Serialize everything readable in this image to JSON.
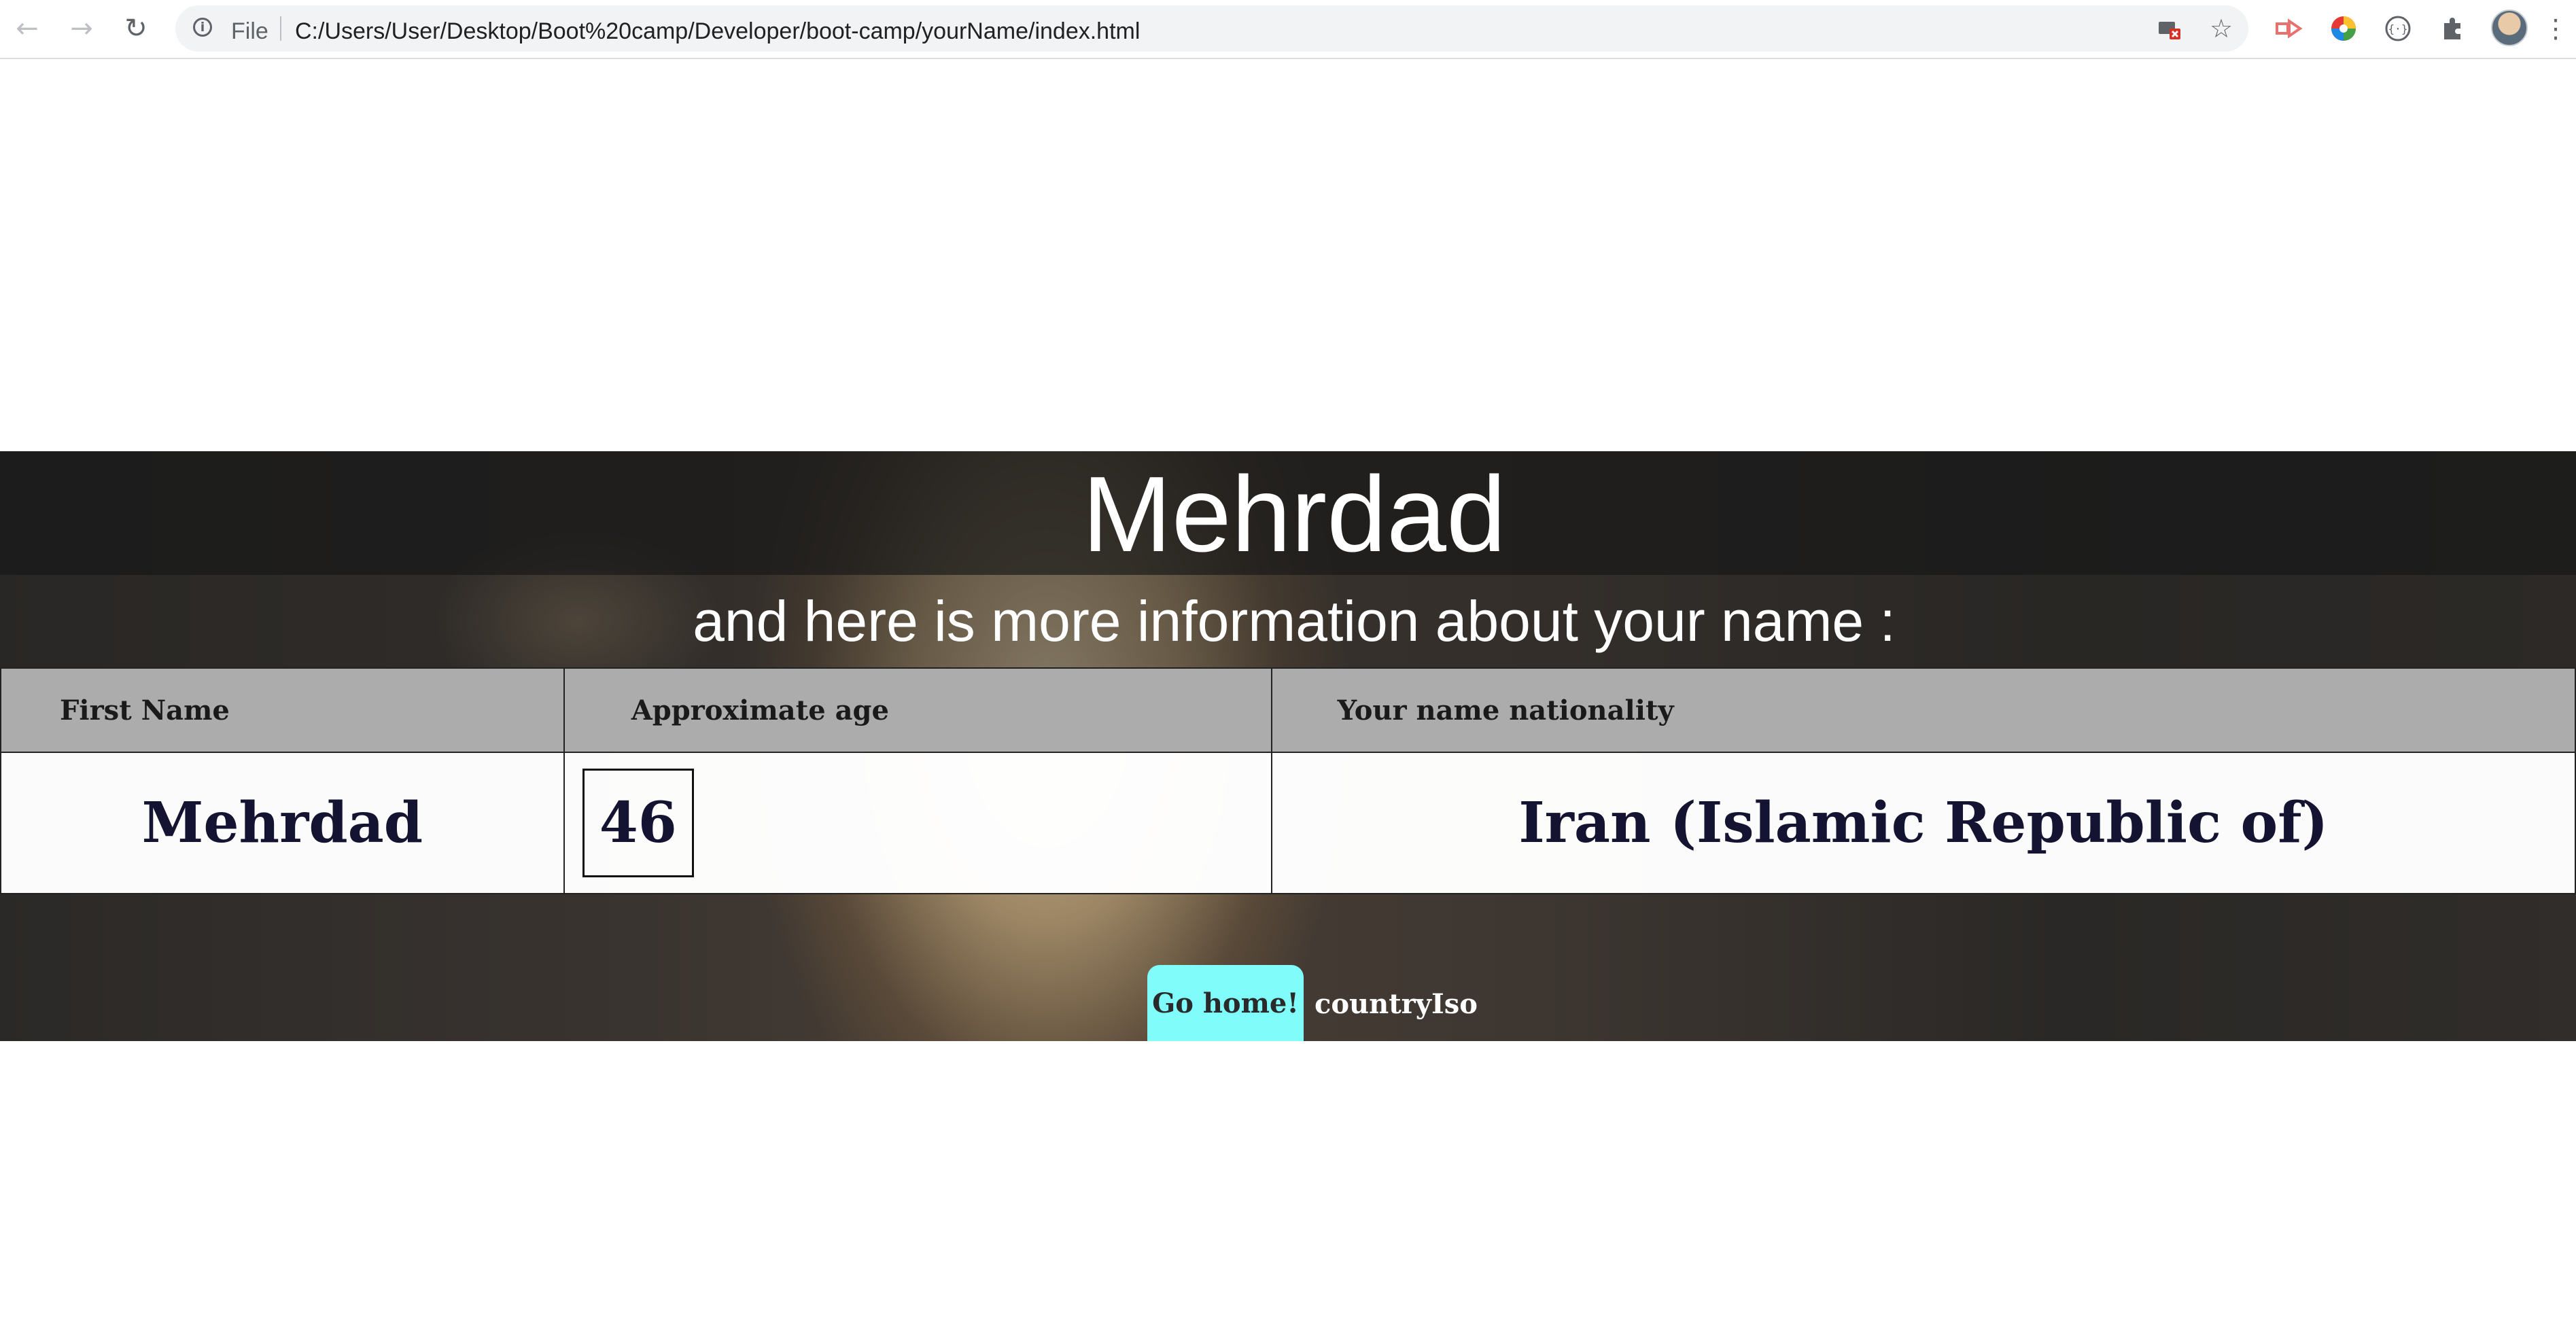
{
  "browser": {
    "back_icon": "arrow-left-icon",
    "forward_icon": "arrow-right-icon",
    "reload_icon": "reload-icon",
    "scheme_label": "File",
    "url": "C:/Users/User/Desktop/Boot%20camp/Developer/boot-camp/yourName/index.html",
    "extensions": [
      "cast-blocked-icon",
      "star-icon",
      "extension-arrow-icon",
      "color-wheel-icon",
      "code-extension-icon",
      "puzzle-icon",
      "profile-avatar",
      "menu-dots-icon"
    ]
  },
  "hero": {
    "title": "Mehrdad",
    "subtitle": "and here is more information about your name :"
  },
  "table": {
    "headers": [
      "First Name",
      "Approximate age",
      "Your name nationality"
    ],
    "row": {
      "first_name": "Mehrdad",
      "age": "46",
      "nationality": "Iran (Islamic Republic of)"
    }
  },
  "footer": {
    "go_home_label": "Go home!",
    "country_iso_label": "countryIso"
  },
  "colors": {
    "button_bg": "#80fcfb",
    "header_bg": "#acacac",
    "title_band": "#1a1a1a",
    "cell_text": "#141432"
  }
}
